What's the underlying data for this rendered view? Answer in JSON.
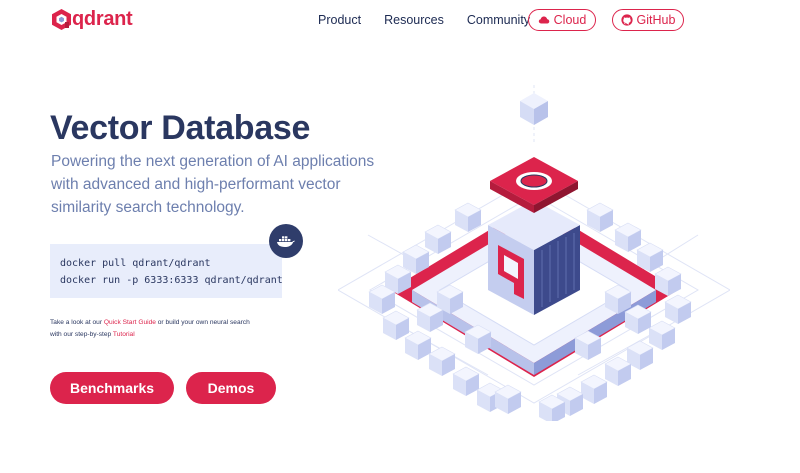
{
  "brand": {
    "name": "qdrant",
    "accent": "#dc244c",
    "navy": "#2a3760",
    "light": "#e8edfb"
  },
  "nav": {
    "links": [
      "Product",
      "Resources",
      "Community"
    ],
    "cloud_label": "Cloud",
    "github_label": "GitHub",
    "icons": {
      "cloud": "cloud-icon",
      "github": "github-icon"
    }
  },
  "hero": {
    "title": "Vector Database",
    "subtitle_lines": [
      "Powering the next generation of AI applications",
      "with advanced and high-performant vector",
      "similarity search technology."
    ]
  },
  "code": {
    "lines": [
      "docker pull qdrant/qdrant",
      "docker run -p 6333:6333 qdrant/qdrant"
    ],
    "badge_icon": "docker-icon"
  },
  "hint": {
    "text_1": "Take a look at our ",
    "link_1": "Quick Start Guide",
    "text_2": " or build your own neural search",
    "text_3": "with our step-by-step ",
    "link_2": "Tutorial"
  },
  "buttons": {
    "benchmarks": "Benchmarks",
    "demos": "Demos"
  }
}
